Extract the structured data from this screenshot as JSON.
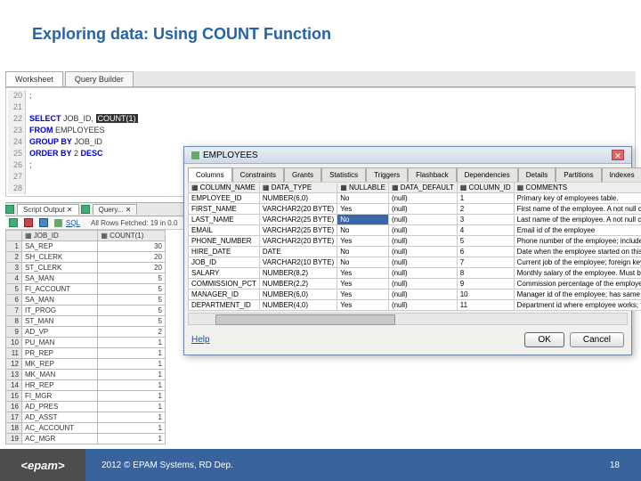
{
  "title": "Exploring data: Using COUNT Function",
  "worksheetTabs": [
    "Worksheet",
    "Query Builder"
  ],
  "sql": {
    "lines": [
      {
        "n": 20,
        "t": ";"
      },
      {
        "n": 21,
        "t": ""
      },
      {
        "n": 22,
        "t": "SELECT JOB_ID, COUNT(1)",
        "kw": [
          "SELECT"
        ],
        "hl": "COUNT(1)"
      },
      {
        "n": 23,
        "t": "FROM EMPLOYEES",
        "kw": [
          "FROM"
        ]
      },
      {
        "n": 24,
        "t": "GROUP BY JOB_ID",
        "kw": [
          "GROUP BY"
        ]
      },
      {
        "n": 25,
        "t": "ORDER BY 2 DESC",
        "kw": [
          "ORDER BY",
          "DESC"
        ]
      },
      {
        "n": 26,
        "t": ";"
      },
      {
        "n": 27,
        "t": ""
      },
      {
        "n": 28,
        "t": ""
      }
    ]
  },
  "outputTabs": [
    "Script Output",
    "Query..."
  ],
  "toolsLabel": "SQL",
  "fetchStatus": "All Rows Fetched: 19 in 0.0",
  "result": {
    "headers": [
      "JOB_ID",
      "COUNT(1)"
    ],
    "rows": [
      [
        "1",
        "SA_REP",
        "30"
      ],
      [
        "2",
        "SH_CLERK",
        "20"
      ],
      [
        "3",
        "ST_CLERK",
        "20"
      ],
      [
        "4",
        "SA_MAN",
        "5"
      ],
      [
        "5",
        "FI_ACCOUNT",
        "5"
      ],
      [
        "6",
        "SA_MAN",
        "5"
      ],
      [
        "7",
        "IT_PROG",
        "5"
      ],
      [
        "8",
        "ST_MAN",
        "5"
      ],
      [
        "9",
        "AD_VP",
        "2"
      ],
      [
        "10",
        "PU_MAN",
        "1"
      ],
      [
        "11",
        "PR_REP",
        "1"
      ],
      [
        "12",
        "MK_REP",
        "1"
      ],
      [
        "13",
        "MK_MAN",
        "1"
      ],
      [
        "14",
        "HR_REP",
        "1"
      ],
      [
        "15",
        "FI_MGR",
        "1"
      ],
      [
        "16",
        "AD_PRES",
        "1"
      ],
      [
        "17",
        "AD_ASST",
        "1"
      ],
      [
        "18",
        "AC_ACCOUNT",
        "1"
      ],
      [
        "19",
        "AC_MGR",
        "1"
      ]
    ]
  },
  "dialog": {
    "title": "EMPLOYEES",
    "tabs": [
      "Columns",
      "Constraints",
      "Grants",
      "Statistics",
      "Triggers",
      "Flashback",
      "Dependencies",
      "Details",
      "Partitions",
      "Indexes"
    ],
    "gridHeaders": [
      "COLUMN_NAME",
      "DATA_TYPE",
      "NULLABLE",
      "DATA_DEFAULT",
      "COLUMN_ID",
      "COMMENTS"
    ],
    "rows": [
      [
        "EMPLOYEE_ID",
        "NUMBER(6,0)",
        "No",
        "(null)",
        "1",
        "Primary key of employees table."
      ],
      [
        "FIRST_NAME",
        "VARCHAR2(20 BYTE)",
        "Yes",
        "(null)",
        "2",
        "First name of the employee. A not null column."
      ],
      [
        "LAST_NAME",
        "VARCHAR2(25 BYTE)",
        "No",
        "(null)",
        "3",
        "Last name of the employee. A not null column."
      ],
      [
        "EMAIL",
        "VARCHAR2(25 BYTE)",
        "No",
        "(null)",
        "4",
        "Email id of the employee"
      ],
      [
        "PHONE_NUMBER",
        "VARCHAR2(20 BYTE)",
        "Yes",
        "(null)",
        "5",
        "Phone number of the employee; includes country"
      ],
      [
        "HIRE_DATE",
        "DATE",
        "No",
        "(null)",
        "6",
        "Date when the employee started on this job. A n"
      ],
      [
        "JOB_ID",
        "VARCHAR2(10 BYTE)",
        "No",
        "(null)",
        "7",
        "Current job of the employee; foreign key to job"
      ],
      [
        "SALARY",
        "NUMBER(8,2)",
        "Yes",
        "(null)",
        "8",
        "Monthly salary of the employee. Must be greater"
      ],
      [
        "COMMISSION_PCT",
        "NUMBER(2,2)",
        "Yes",
        "(null)",
        "9",
        "Commission percentage of the employee; Only emp"
      ],
      [
        "MANAGER_ID",
        "NUMBER(6,0)",
        "Yes",
        "(null)",
        "10",
        "Manager id of the employee; has same domain as"
      ],
      [
        "DEPARTMENT_ID",
        "NUMBER(4,0)",
        "Yes",
        "(null)",
        "11",
        "Department id where employee works; foreign key"
      ]
    ],
    "selectedCell": {
      "row": 2,
      "col": 2
    },
    "help": "Help",
    "ok": "OK",
    "cancel": "Cancel"
  },
  "footer": {
    "logo": "<epam>",
    "copyright": "2012 © EPAM Systems, RD Dep.",
    "page": "18"
  }
}
